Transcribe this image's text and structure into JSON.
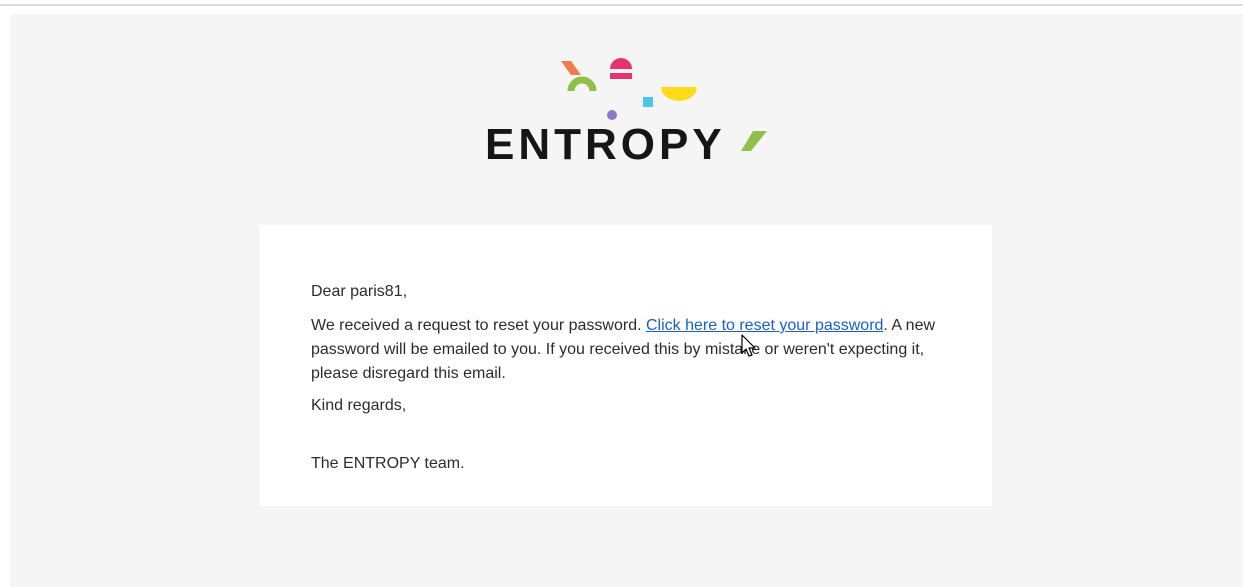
{
  "brand": {
    "name": "ENTROPY",
    "colors": {
      "orange": "#f07c4c",
      "green": "#8fc04a",
      "pink": "#e6326e",
      "purple": "#8a7ac8",
      "cyan": "#4cc6ec",
      "yellow": "#fddb16",
      "wordmark": "#161616"
    }
  },
  "email": {
    "greeting": "Dear paris81,",
    "body_before_link": "We received a request to reset your password. ",
    "link_text": "Click here to reset your password",
    "body_after_link": ". A new password will be emailed to you. If you received this by mistake or weren't expecting it, please disregard this email.",
    "closing": "Kind regards,",
    "signature": "The ENTROPY team."
  },
  "colors": {
    "page_background": "#f5f5f5",
    "card_background": "#ffffff",
    "text": "#2b2b2b",
    "link": "#1a5fc8"
  }
}
